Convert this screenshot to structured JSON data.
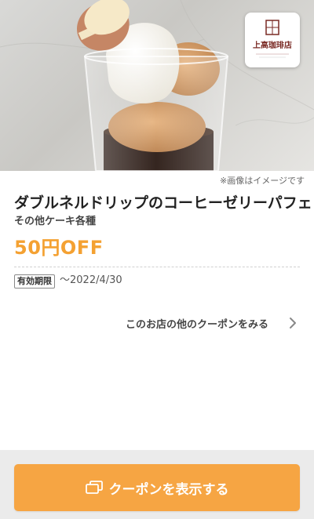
{
  "hero": {
    "image_note": "※画像はイメージです"
  },
  "shop": {
    "logo_text": "上高珈琲店",
    "logo_seal": "上高"
  },
  "product": {
    "title": "ダブルネルドリップのコーヒーゼリーパフェ",
    "subtitle": "その他ケーキ各種",
    "discount": "50円OFF"
  },
  "validity": {
    "label": "有効期限",
    "value": "〜2022/4/30"
  },
  "links": {
    "other_coupons": "このお店の他のクーポンをみる"
  },
  "cta": {
    "label": "クーポンを表示する"
  },
  "colors": {
    "accent": "#f4a132",
    "button": "#f6a543",
    "footer_bg": "#ebebeb"
  },
  "icons": {
    "logo": "shop-logo-icon",
    "chevron": "chevron-right-icon",
    "coupon": "coupon-icon"
  }
}
